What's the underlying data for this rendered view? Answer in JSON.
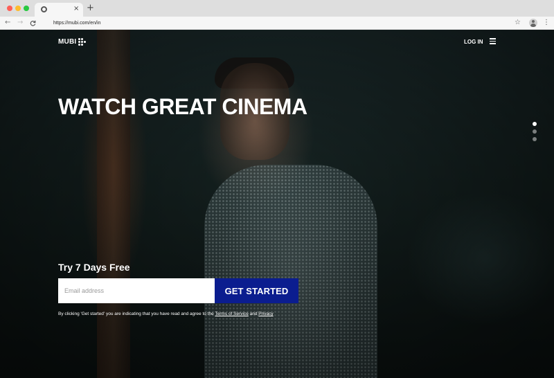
{
  "browser": {
    "tab": {
      "favicon": "chrome-globe-icon",
      "close_glyph": "×"
    },
    "new_tab_glyph": "+",
    "nav": {
      "back": "←",
      "forward": "→",
      "reload": "C"
    },
    "url": "https://mubi.com/en/in",
    "icons": {
      "bookmark": "star-icon",
      "profile": "profile-icon",
      "menu": "kebab-menu-icon"
    },
    "star_glyph": "☆",
    "menu_glyph": "⋮"
  },
  "header": {
    "logo_text": "MUBI",
    "login_label": "LOG IN",
    "menu_icon": "hamburger-icon"
  },
  "hero": {
    "headline": "WATCH GREAT CINEMA",
    "slides": {
      "count": 3,
      "active_index": 0
    }
  },
  "signup": {
    "title": "Try 7 Days Free",
    "email_placeholder": "Email address",
    "cta_label": "GET STARTED",
    "legal_text": "By clicking 'Get started' you are indicating that you have read and agree to the",
    "terms_label": "Terms of Service",
    "and_text": "and",
    "privacy_label": "Privacy"
  },
  "colors": {
    "cta_background": "#0b1d8f",
    "text": "#ffffff"
  }
}
